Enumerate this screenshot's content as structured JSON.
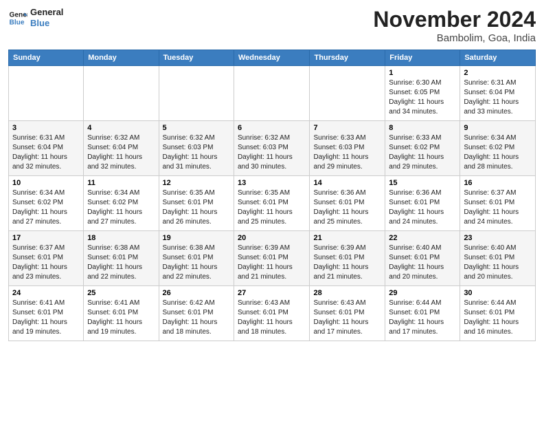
{
  "header": {
    "logo_line1": "General",
    "logo_line2": "Blue",
    "month_title": "November 2024",
    "location": "Bambolim, Goa, India"
  },
  "weekdays": [
    "Sunday",
    "Monday",
    "Tuesday",
    "Wednesday",
    "Thursday",
    "Friday",
    "Saturday"
  ],
  "weeks": [
    [
      {
        "day": "",
        "info": ""
      },
      {
        "day": "",
        "info": ""
      },
      {
        "day": "",
        "info": ""
      },
      {
        "day": "",
        "info": ""
      },
      {
        "day": "",
        "info": ""
      },
      {
        "day": "1",
        "info": "Sunrise: 6:30 AM\nSunset: 6:05 PM\nDaylight: 11 hours\nand 34 minutes."
      },
      {
        "day": "2",
        "info": "Sunrise: 6:31 AM\nSunset: 6:04 PM\nDaylight: 11 hours\nand 33 minutes."
      }
    ],
    [
      {
        "day": "3",
        "info": "Sunrise: 6:31 AM\nSunset: 6:04 PM\nDaylight: 11 hours\nand 32 minutes."
      },
      {
        "day": "4",
        "info": "Sunrise: 6:32 AM\nSunset: 6:04 PM\nDaylight: 11 hours\nand 32 minutes."
      },
      {
        "day": "5",
        "info": "Sunrise: 6:32 AM\nSunset: 6:03 PM\nDaylight: 11 hours\nand 31 minutes."
      },
      {
        "day": "6",
        "info": "Sunrise: 6:32 AM\nSunset: 6:03 PM\nDaylight: 11 hours\nand 30 minutes."
      },
      {
        "day": "7",
        "info": "Sunrise: 6:33 AM\nSunset: 6:03 PM\nDaylight: 11 hours\nand 29 minutes."
      },
      {
        "day": "8",
        "info": "Sunrise: 6:33 AM\nSunset: 6:02 PM\nDaylight: 11 hours\nand 29 minutes."
      },
      {
        "day": "9",
        "info": "Sunrise: 6:34 AM\nSunset: 6:02 PM\nDaylight: 11 hours\nand 28 minutes."
      }
    ],
    [
      {
        "day": "10",
        "info": "Sunrise: 6:34 AM\nSunset: 6:02 PM\nDaylight: 11 hours\nand 27 minutes."
      },
      {
        "day": "11",
        "info": "Sunrise: 6:34 AM\nSunset: 6:02 PM\nDaylight: 11 hours\nand 27 minutes."
      },
      {
        "day": "12",
        "info": "Sunrise: 6:35 AM\nSunset: 6:01 PM\nDaylight: 11 hours\nand 26 minutes."
      },
      {
        "day": "13",
        "info": "Sunrise: 6:35 AM\nSunset: 6:01 PM\nDaylight: 11 hours\nand 25 minutes."
      },
      {
        "day": "14",
        "info": "Sunrise: 6:36 AM\nSunset: 6:01 PM\nDaylight: 11 hours\nand 25 minutes."
      },
      {
        "day": "15",
        "info": "Sunrise: 6:36 AM\nSunset: 6:01 PM\nDaylight: 11 hours\nand 24 minutes."
      },
      {
        "day": "16",
        "info": "Sunrise: 6:37 AM\nSunset: 6:01 PM\nDaylight: 11 hours\nand 24 minutes."
      }
    ],
    [
      {
        "day": "17",
        "info": "Sunrise: 6:37 AM\nSunset: 6:01 PM\nDaylight: 11 hours\nand 23 minutes."
      },
      {
        "day": "18",
        "info": "Sunrise: 6:38 AM\nSunset: 6:01 PM\nDaylight: 11 hours\nand 22 minutes."
      },
      {
        "day": "19",
        "info": "Sunrise: 6:38 AM\nSunset: 6:01 PM\nDaylight: 11 hours\nand 22 minutes."
      },
      {
        "day": "20",
        "info": "Sunrise: 6:39 AM\nSunset: 6:01 PM\nDaylight: 11 hours\nand 21 minutes."
      },
      {
        "day": "21",
        "info": "Sunrise: 6:39 AM\nSunset: 6:01 PM\nDaylight: 11 hours\nand 21 minutes."
      },
      {
        "day": "22",
        "info": "Sunrise: 6:40 AM\nSunset: 6:01 PM\nDaylight: 11 hours\nand 20 minutes."
      },
      {
        "day": "23",
        "info": "Sunrise: 6:40 AM\nSunset: 6:01 PM\nDaylight: 11 hours\nand 20 minutes."
      }
    ],
    [
      {
        "day": "24",
        "info": "Sunrise: 6:41 AM\nSunset: 6:01 PM\nDaylight: 11 hours\nand 19 minutes."
      },
      {
        "day": "25",
        "info": "Sunrise: 6:41 AM\nSunset: 6:01 PM\nDaylight: 11 hours\nand 19 minutes."
      },
      {
        "day": "26",
        "info": "Sunrise: 6:42 AM\nSunset: 6:01 PM\nDaylight: 11 hours\nand 18 minutes."
      },
      {
        "day": "27",
        "info": "Sunrise: 6:43 AM\nSunset: 6:01 PM\nDaylight: 11 hours\nand 18 minutes."
      },
      {
        "day": "28",
        "info": "Sunrise: 6:43 AM\nSunset: 6:01 PM\nDaylight: 11 hours\nand 17 minutes."
      },
      {
        "day": "29",
        "info": "Sunrise: 6:44 AM\nSunset: 6:01 PM\nDaylight: 11 hours\nand 17 minutes."
      },
      {
        "day": "30",
        "info": "Sunrise: 6:44 AM\nSunset: 6:01 PM\nDaylight: 11 hours\nand 16 minutes."
      }
    ]
  ]
}
